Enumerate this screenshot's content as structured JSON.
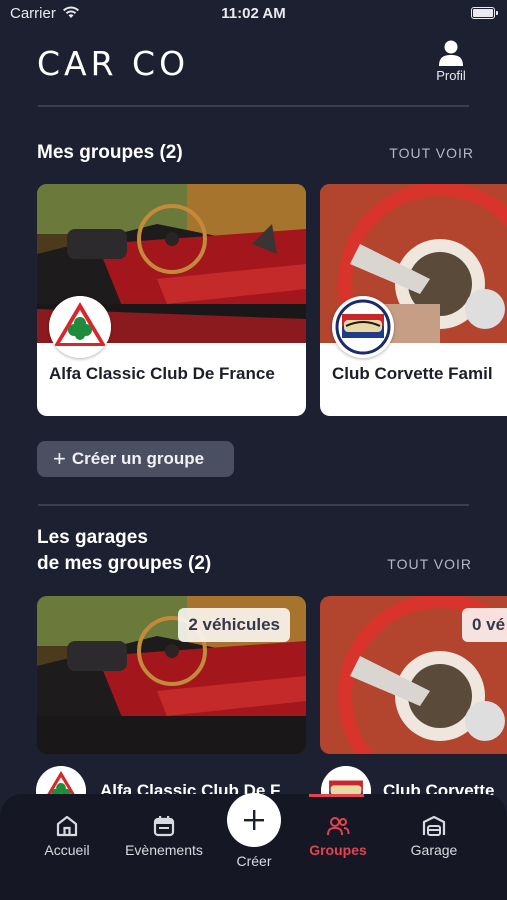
{
  "status_bar": {
    "carrier": "Carrier",
    "time": "11:02 AM",
    "battery_level": 1.0
  },
  "header": {
    "logo": "CAR CO",
    "profile_label": "Profil"
  },
  "my_groups": {
    "title": "Mes groupes (2)",
    "see_all": "TOUT VOIR",
    "cards": [
      {
        "name": "Alfa Classic Club De France",
        "logo": "alfa-cloverleaf-logo"
      },
      {
        "name": "Club Corvette Famil",
        "logo": "corvette-family-logo"
      }
    ],
    "create_label": "Créer un groupe"
  },
  "garages": {
    "title_line1": "Les garages",
    "title_line2": "de mes groupes (2)",
    "see_all": "TOUT VOIR",
    "cards": [
      {
        "vehicles": "2 véhicules",
        "name": "Alfa Classic Club De F"
      },
      {
        "vehicles": "0 vé",
        "name": "Club Corvette"
      }
    ]
  },
  "tabbar": {
    "home": "Accueil",
    "events": "Evènements",
    "create": "Créer",
    "groups": "Groupes",
    "garage": "Garage",
    "active_color": "#e2434f"
  }
}
